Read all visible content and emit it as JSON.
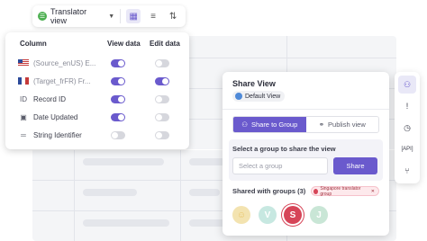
{
  "toolbar": {
    "view_label": "Translator view",
    "icons": [
      "grid-icon",
      "filter-icon",
      "sort-icon"
    ]
  },
  "columns_panel": {
    "headers": {
      "column": "Column",
      "view": "View data",
      "edit": "Edit data"
    },
    "rows": [
      {
        "label": "(Source_enUS) E...",
        "icon": "flag-us-icon",
        "view": true,
        "edit": false
      },
      {
        "label": "(Target_frFR) Fr...",
        "icon": "flag-fr-icon",
        "view": true,
        "edit": true
      },
      {
        "label": "Record ID",
        "icon": "id-icon",
        "view": true,
        "edit": false
      },
      {
        "label": "Date Updated",
        "icon": "calendar-icon",
        "view": true,
        "edit": false
      },
      {
        "label": "String Identifier",
        "icon": "text-icon",
        "view": false,
        "edit": false
      }
    ]
  },
  "share_panel": {
    "title": "Share View",
    "default_view": "Default View",
    "tabs": {
      "group": "Share to Group",
      "publish": "Publish view"
    },
    "group_label": "Select a group to share the view",
    "input_placeholder": "Select a group",
    "share_button": "Share",
    "shared_label": "Shared with groups (3)",
    "chip": "Singapore translator group",
    "avatars": [
      "V",
      "S",
      "J"
    ]
  },
  "accent_color": "#6a5acd"
}
